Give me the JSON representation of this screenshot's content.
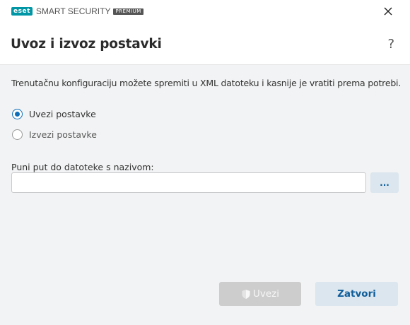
{
  "window": {
    "brand": "eset",
    "product": "SMART SECURITY",
    "edition": "PREMIUM",
    "close_icon": "close-icon"
  },
  "header": {
    "title": "Uvoz i izvoz postavki",
    "help_label": "?"
  },
  "body": {
    "description": "Trenutačnu konfiguraciju možete spremiti u XML datoteku i kasnije je vratiti prema potrebi.",
    "options": [
      {
        "label": "Uvezi postavke",
        "selected": true
      },
      {
        "label": "Izvezi postavke",
        "selected": false
      }
    ],
    "path_label": "Puni put do datoteke s nazivom:",
    "path_value": "",
    "browse_label": "..."
  },
  "footer": {
    "import_label": "Uvezi",
    "import_enabled": false,
    "close_label": "Zatvori"
  },
  "colors": {
    "accent": "#0e6fb8",
    "brand": "#0096a6",
    "button_secondary_bg": "#dbe6ee",
    "button_disabled_bg": "#cdcdcd"
  }
}
